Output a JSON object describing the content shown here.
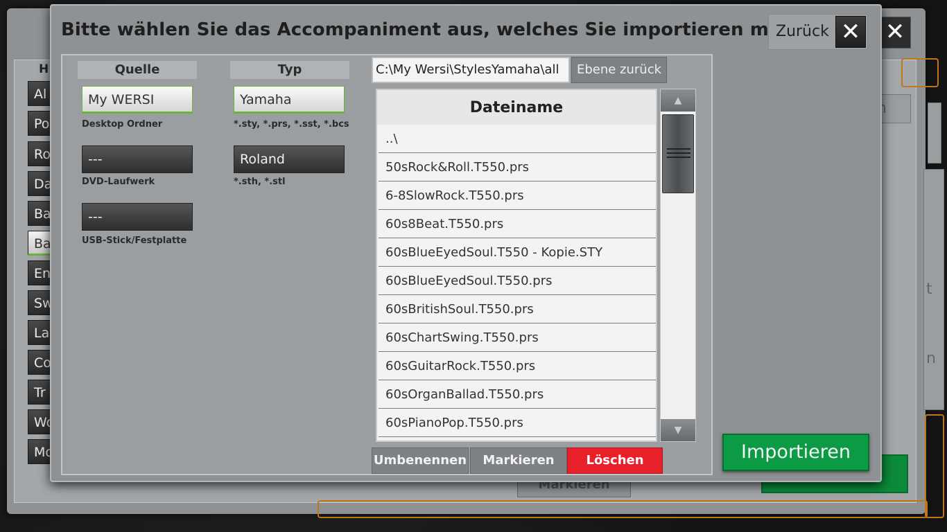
{
  "background_window": {
    "header_partial": "H",
    "categories": [
      "Al",
      "Po",
      "Ro",
      "Da",
      "Ba",
      "Ba",
      "En",
      "Sw",
      "La",
      "Co",
      "Tr",
      "Wo",
      "Mo"
    ],
    "selected_category_index": 5,
    "right_partials": [
      "n",
      "t",
      "n"
    ],
    "markieren_label": "Markieren"
  },
  "dialog": {
    "title": "Bitte wählen Sie das Accompaniment aus, welches Sie importieren möchten.",
    "back_label": "Zurück",
    "close_glyph": "✕"
  },
  "source": {
    "header": "Quelle",
    "buttons": [
      {
        "label": "My WERSI",
        "caption": "Desktop Ordner",
        "selected": true
      },
      {
        "label": "---",
        "caption": "DVD-Laufwerk",
        "selected": false
      },
      {
        "label": "---",
        "caption": "USB-Stick/Festplatte",
        "selected": false
      }
    ]
  },
  "type": {
    "header": "Typ",
    "buttons": [
      {
        "label": "Yamaha",
        "caption": "*.sty, *.prs, *.sst, *.bcs",
        "selected": true
      },
      {
        "label": "Roland",
        "caption": "*.sth, *.stl",
        "selected": false
      }
    ]
  },
  "path": {
    "value": "C:\\My Wersi\\StylesYamaha\\all",
    "up_label": "Ebene zurück"
  },
  "file_list": {
    "header": "Dateiname",
    "rows": [
      "..\\",
      "50sRock&Roll.T550.prs",
      "6-8SlowRock.T550.prs",
      "60s8Beat.T550.prs",
      "60sBlueEyedSoul.T550 - Kopie.STY",
      "60sBlueEyedSoul.T550.prs",
      "60sBritishSoul.T550.prs",
      "60sChartSwing.T550.prs",
      "60sGuitarRock.T550.prs",
      "60sOrganBallad.T550.prs",
      "60sPianoPop.T550.prs"
    ]
  },
  "actions": {
    "rename": "Umbenennen",
    "mark": "Markieren",
    "delete": "Löschen"
  },
  "import_label": "Importieren",
  "colors": {
    "accent_green": "#0c9a44",
    "delete_red": "#e8202a",
    "selection_green": "#6cb23c",
    "orange_frame": "#c2761a"
  },
  "icons": {
    "scroll_up": "triangle-up-icon",
    "scroll_down": "triangle-down-icon",
    "close": "close-icon",
    "scroll_grip": "grip-lines-icon"
  }
}
